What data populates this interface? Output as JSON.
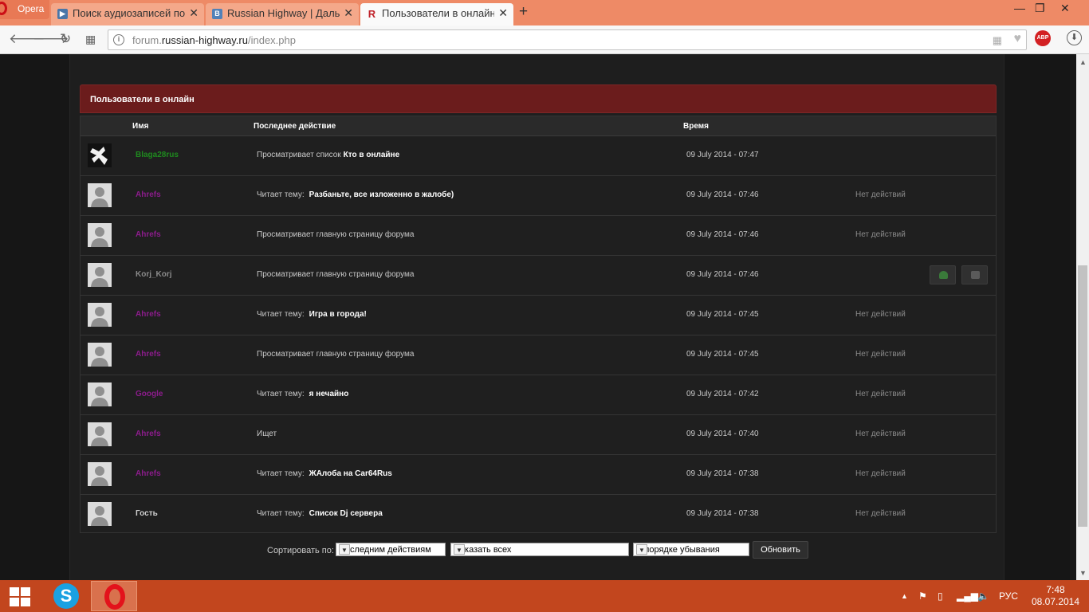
{
  "browser": {
    "menu_label": "Opera",
    "tabs": [
      {
        "title": "Поиск аудиозаписей по з",
        "favicon": "play-icon",
        "color": "#4a76a8"
      },
      {
        "title": "Russian Highway | Дально",
        "favicon": "vk-icon",
        "color": "#5181b8"
      },
      {
        "title": "Пользователи в онлайн –",
        "favicon": "R",
        "color": "#c0222a"
      }
    ],
    "url_prefix": "forum.",
    "url_host": "russian-highway.ru",
    "url_path": "/index.php"
  },
  "panel": {
    "title": "Пользователи в онлайн"
  },
  "table": {
    "headers": {
      "name": "Имя",
      "action": "Последнее действие",
      "time": "Время"
    },
    "rows": [
      {
        "name": "Blaga28rus",
        "name_color": "#1f8a1f",
        "avatar": "custom",
        "action_prefix": "Просматривает список",
        "action_link": "Кто в онлайне",
        "time": "09 July 2014 - 07:47",
        "options": "",
        "buttons": false
      },
      {
        "name": "Ahrefs",
        "name_color": "#8b1c8b",
        "avatar": "default",
        "action_prefix": "Читает тему:",
        "action_link": "Разбаньте, все изложенно в жалобе)",
        "time": "09 July 2014 - 07:46",
        "options": "Нет действий",
        "buttons": false
      },
      {
        "name": "Ahrefs",
        "name_color": "#8b1c8b",
        "avatar": "default",
        "action_prefix": "Просматривает главную страницу форума",
        "action_link": "",
        "time": "09 July 2014 - 07:46",
        "options": "Нет действий",
        "buttons": false
      },
      {
        "name": "Korj_Korj",
        "name_color": "#8a8a8a",
        "avatar": "default",
        "action_prefix": "Просматривает главную страницу форума",
        "action_link": "",
        "time": "09 July 2014 - 07:46",
        "options": "",
        "buttons": true
      },
      {
        "name": "Ahrefs",
        "name_color": "#8b1c8b",
        "avatar": "default",
        "action_prefix": "Читает тему:",
        "action_link": "Игра в города!",
        "time": "09 July 2014 - 07:45",
        "options": "Нет действий",
        "buttons": false
      },
      {
        "name": "Ahrefs",
        "name_color": "#8b1c8b",
        "avatar": "default",
        "action_prefix": "Просматривает главную страницу форума",
        "action_link": "",
        "time": "09 July 2014 - 07:45",
        "options": "Нет действий",
        "buttons": false
      },
      {
        "name": "Google",
        "name_color": "#8b1c8b",
        "avatar": "default",
        "action_prefix": "Читает тему:",
        "action_link": "я нечайно",
        "time": "09 July 2014 - 07:42",
        "options": "Нет действий",
        "buttons": false
      },
      {
        "name": "Ahrefs",
        "name_color": "#8b1c8b",
        "avatar": "default",
        "action_prefix": "Ищет",
        "action_link": "",
        "time": "09 July 2014 - 07:40",
        "options": "Нет действий",
        "buttons": false
      },
      {
        "name": "Ahrefs",
        "name_color": "#8b1c8b",
        "avatar": "default",
        "action_prefix": "Читает тему:",
        "action_link": "ЖАлоба на Car64Rus",
        "time": "09 July 2014 - 07:38",
        "options": "Нет действий",
        "buttons": false
      },
      {
        "name": "Гость",
        "name_color": "#cfcfcf",
        "avatar": "default",
        "action_prefix": "Читает тему:",
        "action_link": "Список Dj сервера",
        "time": "09 July 2014 - 07:38",
        "options": "Нет действий",
        "buttons": false
      }
    ]
  },
  "sort": {
    "label": "Сортировать по:",
    "sort_by": "Последним действиям",
    "filter": "Показать всех",
    "order": "В порядке убывания",
    "submit": "Обновить"
  },
  "taskbar": {
    "lang": "РУС",
    "time": "7:48",
    "date": "08.07.2014"
  },
  "colors": {
    "header_bg": "#6b1c1c",
    "taskbar": "#c2461e",
    "tabbar": "#ee8a66"
  }
}
